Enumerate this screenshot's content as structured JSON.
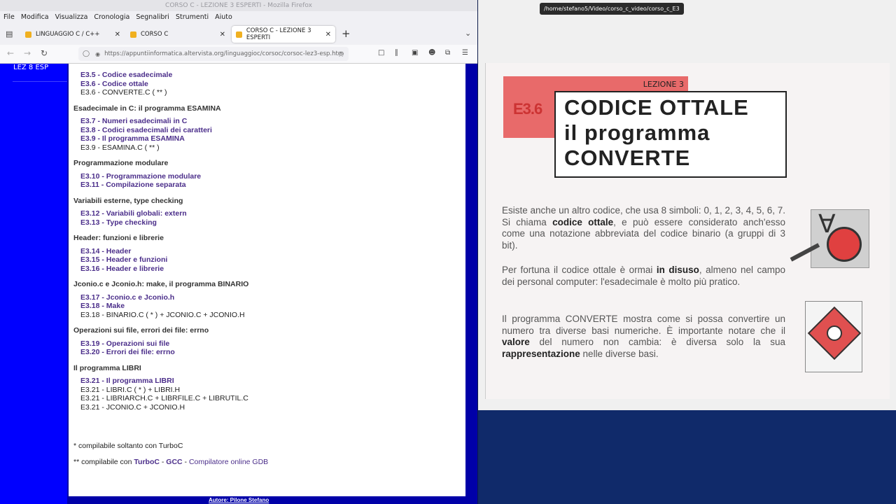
{
  "firefox": {
    "title": "CORSO C - LEZIONE 3 ESPERTI - Mozilla Firefox",
    "menu": [
      "File",
      "Modifica",
      "Visualizza",
      "Cronologia",
      "Segnalibri",
      "Strumenti",
      "Aiuto"
    ],
    "tabs": [
      {
        "label": "LINGUAGGIO C / C++"
      },
      {
        "label": "CORSO C"
      },
      {
        "label": "CORSO C - LEZIONE 3 ESPERTI"
      }
    ],
    "new_tab": "+",
    "url": "https://appuntiinformatica.altervista.org/linguaggioc/corsoc/corsoc-lez3-esp.htm"
  },
  "sidebar": {
    "nav_label": "LEZ 8 ESP"
  },
  "page": {
    "items": [
      {
        "kind": "lnk",
        "text": "E3.5 - Codice esadecimale"
      },
      {
        "kind": "lnk",
        "text": "E3.6 - Codice ottale"
      },
      {
        "kind": "txt",
        "text": "E3.6 - CONVERTE.C ( ** )"
      },
      {
        "kind": "sec",
        "text": "Esadecimale in C: il programma ESAMINA"
      },
      {
        "kind": "lnk",
        "text": "E3.7 - Numeri esadecimali in C"
      },
      {
        "kind": "lnk",
        "text": "E3.8 - Codici esadecimali dei caratteri"
      },
      {
        "kind": "lnk",
        "text": "E3.9 - Il programma ESAMINA"
      },
      {
        "kind": "txt",
        "text": "E3.9 - ESAMINA.C ( ** )"
      },
      {
        "kind": "sec",
        "text": "Programmazione modulare"
      },
      {
        "kind": "lnk",
        "text": "E3.10 - Programmazione modulare"
      },
      {
        "kind": "lnk",
        "text": "E3.11 - Compilazione separata"
      },
      {
        "kind": "sec",
        "text": "Variabili esterne, type checking"
      },
      {
        "kind": "lnk",
        "text": "E3.12 - Variabili globali: extern"
      },
      {
        "kind": "lnk",
        "text": "E3.13 - Type checking"
      },
      {
        "kind": "sec",
        "text": "Header: funzioni e librerie"
      },
      {
        "kind": "lnk",
        "text": "E3.14 - Header"
      },
      {
        "kind": "lnk",
        "text": "E3.15 - Header e funzioni"
      },
      {
        "kind": "lnk",
        "text": "E3.16 - Header e librerie"
      },
      {
        "kind": "sec",
        "text": "Jconio.c e Jconio.h: make, il programma BINARIO"
      },
      {
        "kind": "lnk",
        "text": "E3.17 - Jconio.c e Jconio.h"
      },
      {
        "kind": "lnk",
        "text": "E3.18 - Make"
      },
      {
        "kind": "txt",
        "text": "E3.18 - BINARIO.C ( * ) + JCONIO.C + JCONIO.H"
      },
      {
        "kind": "sec",
        "text": "Operazioni sui file, errori dei file: errno"
      },
      {
        "kind": "lnk",
        "text": "E3.19 - Operazioni sui file"
      },
      {
        "kind": "lnk",
        "text": "E3.20 - Errori dei file: errno"
      },
      {
        "kind": "sec",
        "text": "Il programma LIBRI"
      },
      {
        "kind": "lnk",
        "text": "E3.21 - Il programma LIBRI"
      },
      {
        "kind": "txt",
        "text": "E3.21 - LIBRI.C ( * ) + LIBRI.H"
      },
      {
        "kind": "txt",
        "text": "E3.21 - LIBRIARCH.C + LIBRFILE.C + LIBRUTIL.C"
      },
      {
        "kind": "txt",
        "text": "E3.21 - JCONIO.C + JCONIO.H"
      }
    ],
    "note1": "* compilabile soltanto con TurboC",
    "note2_prefix": "** compilabile con ",
    "note2_turboc": "TurboC",
    "note2_sep1": " - ",
    "note2_gcc": "GCC",
    "note2_sep2": " - ",
    "note2_link": "Compilatore online GDB",
    "author": "Autore: Pilone Stefano"
  },
  "viewer": {
    "tooltip": "/home/stefano5/Video/corso_c_video/corso_c_E3",
    "lesson": "LEZIONE 3",
    "code": "E3.6",
    "title_lines": [
      "CODICE OTTALE",
      "il programma",
      "CONVERTE"
    ],
    "para1_a": "Esiste anche un altro codice, che usa 8 simboli: 0, 1, 2, 3, 4, 5, 6, 7. Si chiama ",
    "para1_b": "codice ottale",
    "para1_c": ", e può essere considerato anch'esso come una notazione abbreviata del codice binario (a gruppi di 3 bit).",
    "para2_a": "Per fortuna il codice ottale è ormai ",
    "para2_b": "in disuso",
    "para2_c": ", almeno nel campo dei personal computer: l'esadecimale è molto più pratico.",
    "para3_a": "Il programma CONVERTE mostra come si possa convertire un numero tra diverse basi numeriche. È importante notare che il ",
    "para3_b": "valore",
    "para3_c": " del numero non cambia: è diversa solo la sua ",
    "para3_d": "rappresentazione",
    "para3_e": " nelle diverse basi."
  }
}
